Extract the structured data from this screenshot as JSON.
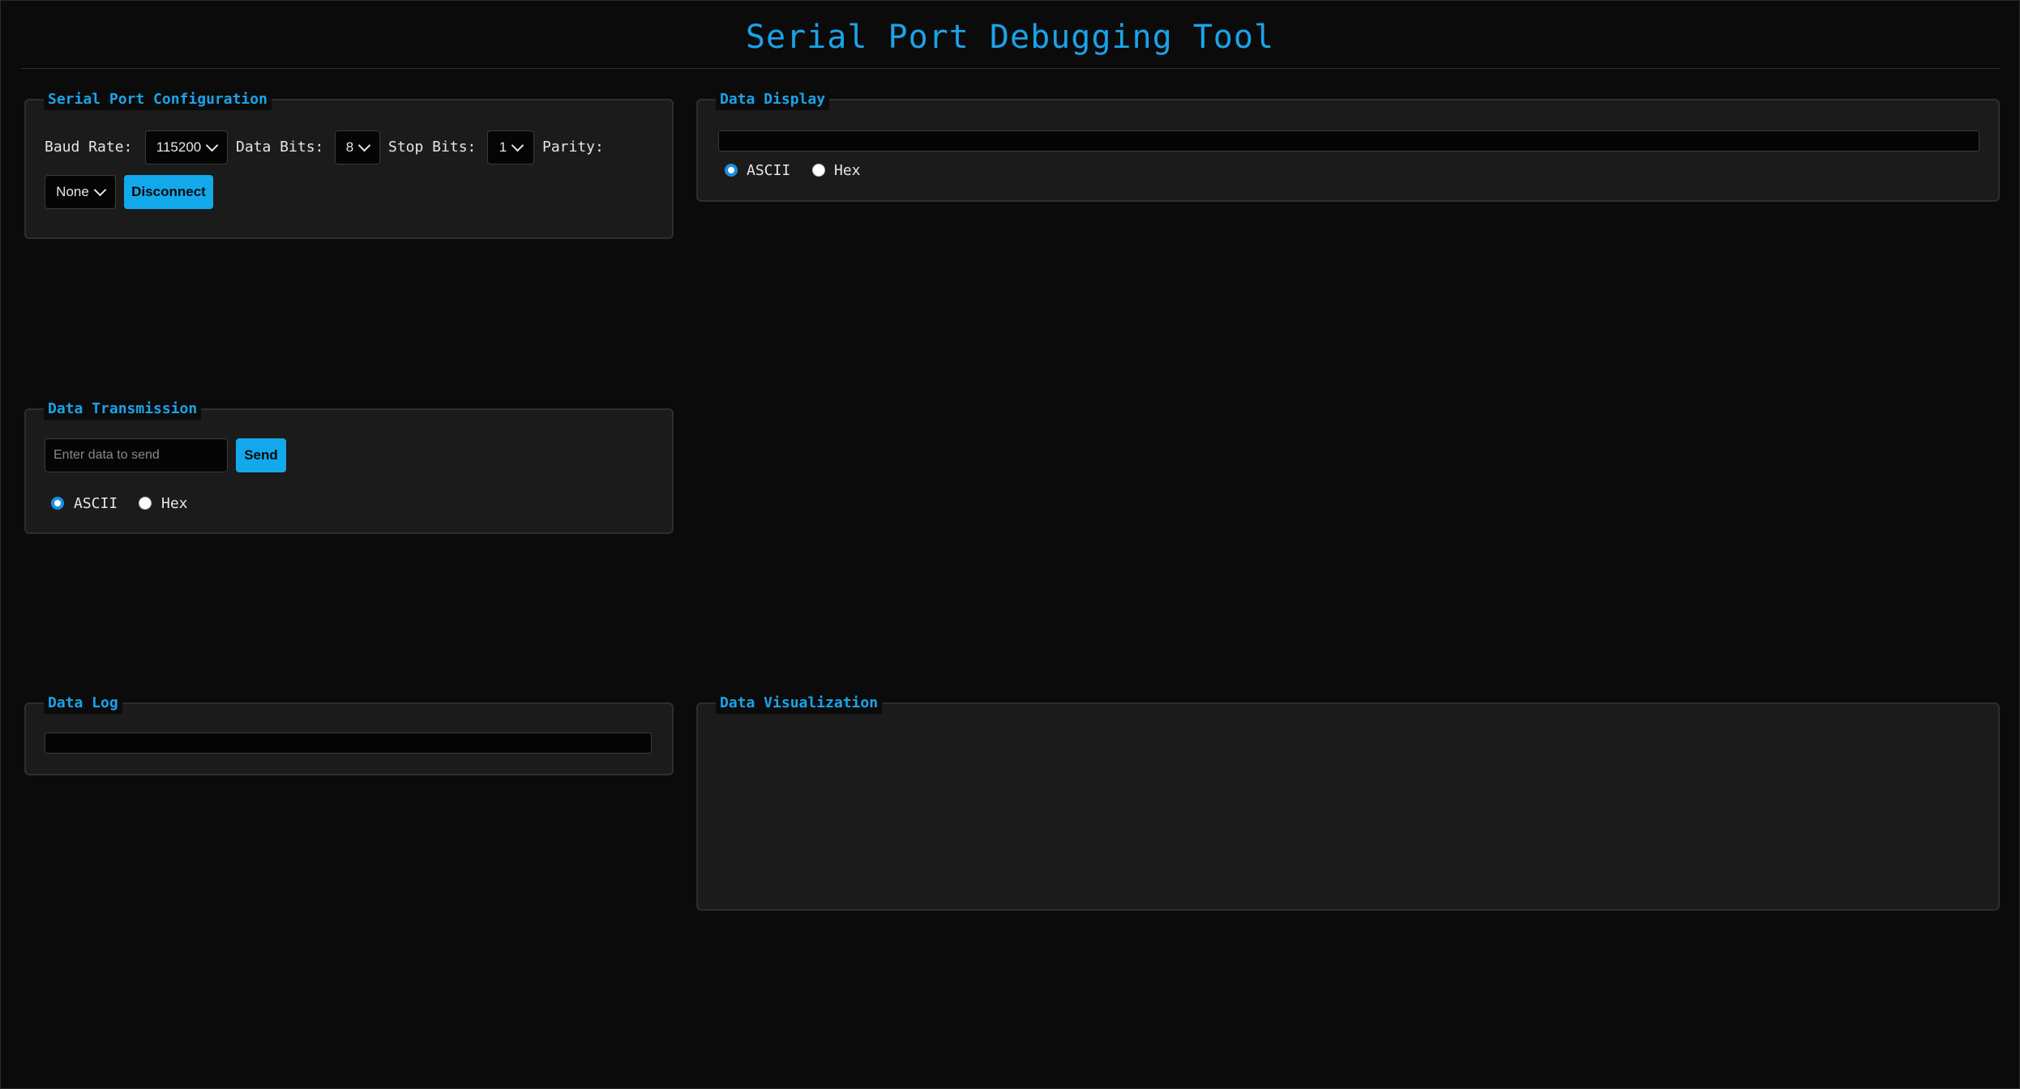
{
  "app": {
    "title": "Serial Port Debugging Tool"
  },
  "config": {
    "legend": "Serial Port Configuration",
    "baud_label": "Baud Rate:",
    "baud_value": "115200",
    "data_bits_label": "Data Bits:",
    "data_bits_value": "8",
    "stop_bits_label": "Stop Bits:",
    "stop_bits_value": "1",
    "parity_label": "Parity:",
    "parity_value": "None",
    "connect_button": "Disconnect"
  },
  "transmission": {
    "legend": "Data Transmission",
    "input_placeholder": "Enter data to send",
    "send_button": "Send",
    "mode_ascii": "ASCII",
    "mode_hex": "Hex",
    "selected_mode": "ASCII"
  },
  "display": {
    "legend": "Data Display",
    "mode_ascii": "ASCII",
    "mode_hex": "Hex",
    "selected_mode": "ASCII"
  },
  "log": {
    "legend": "Data Log"
  },
  "visualization": {
    "legend": "Data Visualization"
  },
  "colors": {
    "accent": "#1aa3e8",
    "button": "#12a9ec",
    "background": "#0b0b0b",
    "panel": "#1b1b1b"
  }
}
